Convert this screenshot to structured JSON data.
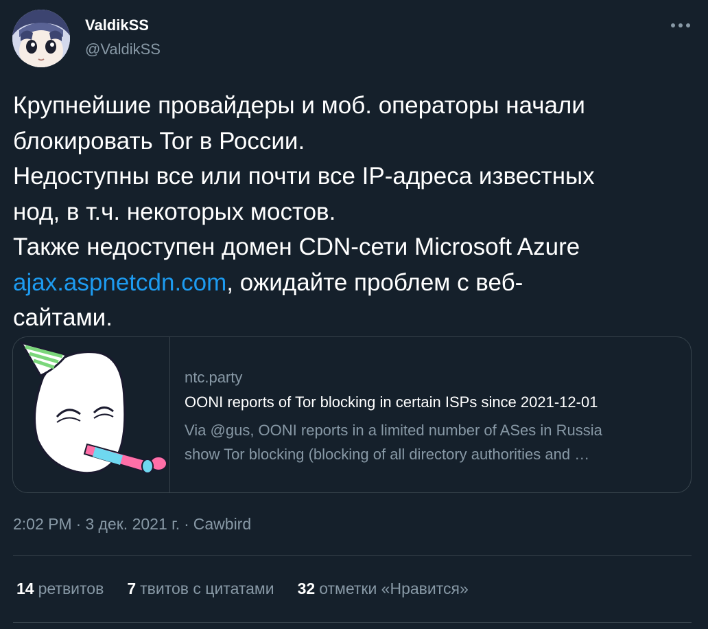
{
  "author": {
    "display_name": "ValdikSS",
    "handle": "@ValdikSS"
  },
  "tweet": {
    "lines": [
      "Крупнейшие провайдеры и моб. операторы начали",
      "блокировать Tor в России.",
      "Недоступны все или почти все IP-адреса известных",
      "нод, в т.ч. некоторых мостов.",
      "Также недоступен домен CDN-сети Microsoft Azure"
    ],
    "link_text": "ajax.aspnetcdn.com",
    "link_after": ", ожидайте проблем с веб-",
    "last_line": "сайтами."
  },
  "card": {
    "domain": "ntc.party",
    "title": "OONI reports of Tor blocking in certain ISPs since 2021-12-01",
    "description_line1": "Via @gus, OONI reports in a limited number of ASes in Russia",
    "description_line2": "show Tor blocking (blocking of all directory authorities and …"
  },
  "meta": {
    "time": "2:02 PM",
    "separator": "·",
    "date": "3 дек. 2021 г.",
    "client": "Cawbird"
  },
  "stats": {
    "retweets_count": "14",
    "retweets_label": "ретвитов",
    "quotes_count": "7",
    "quotes_label": "твитов с цитатами",
    "likes_count": "32",
    "likes_label": "отметки «Нравится»"
  },
  "icons": {
    "more": "more-horizontal-icon"
  },
  "colors": {
    "background": "#15202b",
    "link": "#1d9bf0",
    "secondary_text": "#8899a6",
    "border": "#38444d"
  }
}
